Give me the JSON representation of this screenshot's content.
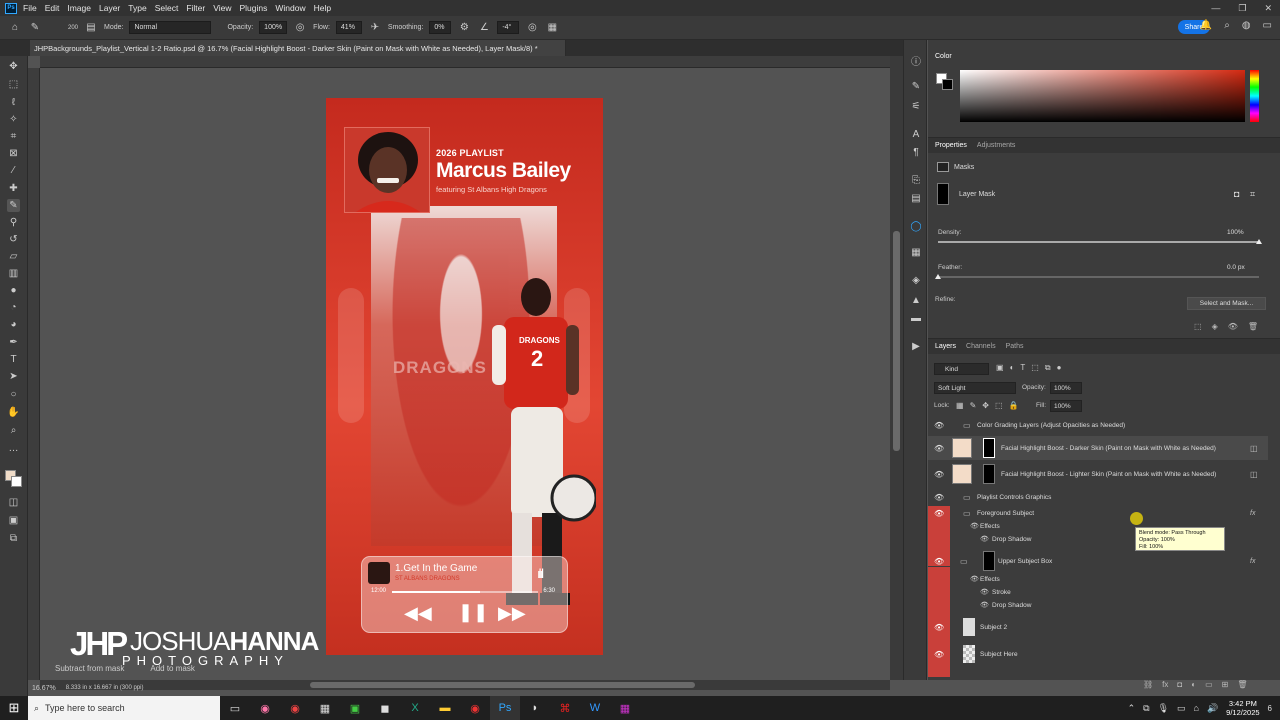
{
  "app": {
    "logo": "Ps",
    "menu": [
      "File",
      "Edit",
      "Image",
      "Layer",
      "Type",
      "Select",
      "Filter",
      "View",
      "Plugins",
      "Window",
      "Help"
    ]
  },
  "options": {
    "brush_size": "200",
    "mode_label": "Mode:",
    "mode_value": "Normal",
    "opacity_label": "Opacity:",
    "opacity_value": "100%",
    "flow_label": "Flow:",
    "flow_value": "41%",
    "smoothing_label": "Smoothing:",
    "smoothing_value": "0%",
    "angle_value": "-4°",
    "share": "Share"
  },
  "document_tab": {
    "title": "JHPBackgrounds_Playlist_Vertical 1-2 Ratio.psd @ 16.7% (Facial Highlight Boost - Darker Skin (Paint on Mask with White as Needed), Layer Mask/8) *"
  },
  "status": {
    "zoom": "16.67%",
    "size": "8.333 in x 16.667 in (300 ppi)"
  },
  "artwork": {
    "playlist_label": "2026 PLAYLIST",
    "player_name": "Marcus Bailey",
    "featuring": "featuring St Albans High Dragons",
    "track_title": "1.Get In the Game",
    "track_sub": "ST ALBANS DRAGONS",
    "time_start": "12:00",
    "time_end": "6:30",
    "progress": 0.6,
    "jersey_text": "DRAGONS",
    "jersey_number": "2"
  },
  "watermark": {
    "name_a": "JOSHUA",
    "name_b": "HANNA",
    "tag": "PHOTOGRAPHY",
    "mask_btn_1": "Subtract from mask",
    "mask_btn_2": "Add to mask"
  },
  "color_panel": {
    "title": "Color",
    "fg": "#ffffff",
    "bg": "#000000",
    "hue": "#d42a12"
  },
  "properties": {
    "tab_active": "Properties",
    "tab_other": "Adjustments",
    "masks_label": "Masks",
    "layer_mask_label": "Layer Mask",
    "density_label": "Density:",
    "density_value": "100%",
    "feather_label": "Feather:",
    "feather_value": "0.0 px",
    "refine_label": "Refine:",
    "select_mask": "Select and Mask..."
  },
  "layers_panel": {
    "tabs": [
      "Layers",
      "Channels",
      "Paths"
    ],
    "filter": "Kind",
    "blend": "Soft Light",
    "opacity_label": "Opacity:",
    "opacity_value": "100%",
    "lock_label": "Lock:",
    "fill_label": "Fill:",
    "fill_value": "100%"
  },
  "layers": [
    {
      "name": "Color Grading Layers (Adjust Opacities as Needed)",
      "type": "group"
    },
    {
      "name": "Facial Highlight Boost - Darker Skin (Paint on Mask with White as Needed)",
      "type": "layer"
    },
    {
      "name": "Facial Highlight Boost - Lighter Skin (Paint on Mask with White as Needed)",
      "type": "layer"
    },
    {
      "name": "Playlist Controls Graphics",
      "type": "group"
    },
    {
      "name": "Foreground Subject",
      "type": "group"
    },
    {
      "name": "Effects",
      "type": "sub"
    },
    {
      "name": "Drop Shadow",
      "type": "sub2"
    },
    {
      "name": "Upper Subject Box",
      "type": "layer"
    },
    {
      "name": "Effects",
      "type": "sub"
    },
    {
      "name": "Stroke",
      "type": "sub2"
    },
    {
      "name": "Drop Shadow",
      "type": "sub2"
    },
    {
      "name": "Subject 2",
      "type": "layer"
    },
    {
      "name": "Subject Here",
      "type": "layer"
    }
  ],
  "tooltip": {
    "line1": "Blend mode: Pass Through",
    "line2": "Opacity: 100%",
    "line3": "Fill: 100%"
  },
  "taskbar": {
    "search_placeholder": "Type here to search",
    "time": "3:42 PM",
    "date": "9/12/2025",
    "notif": "6"
  }
}
